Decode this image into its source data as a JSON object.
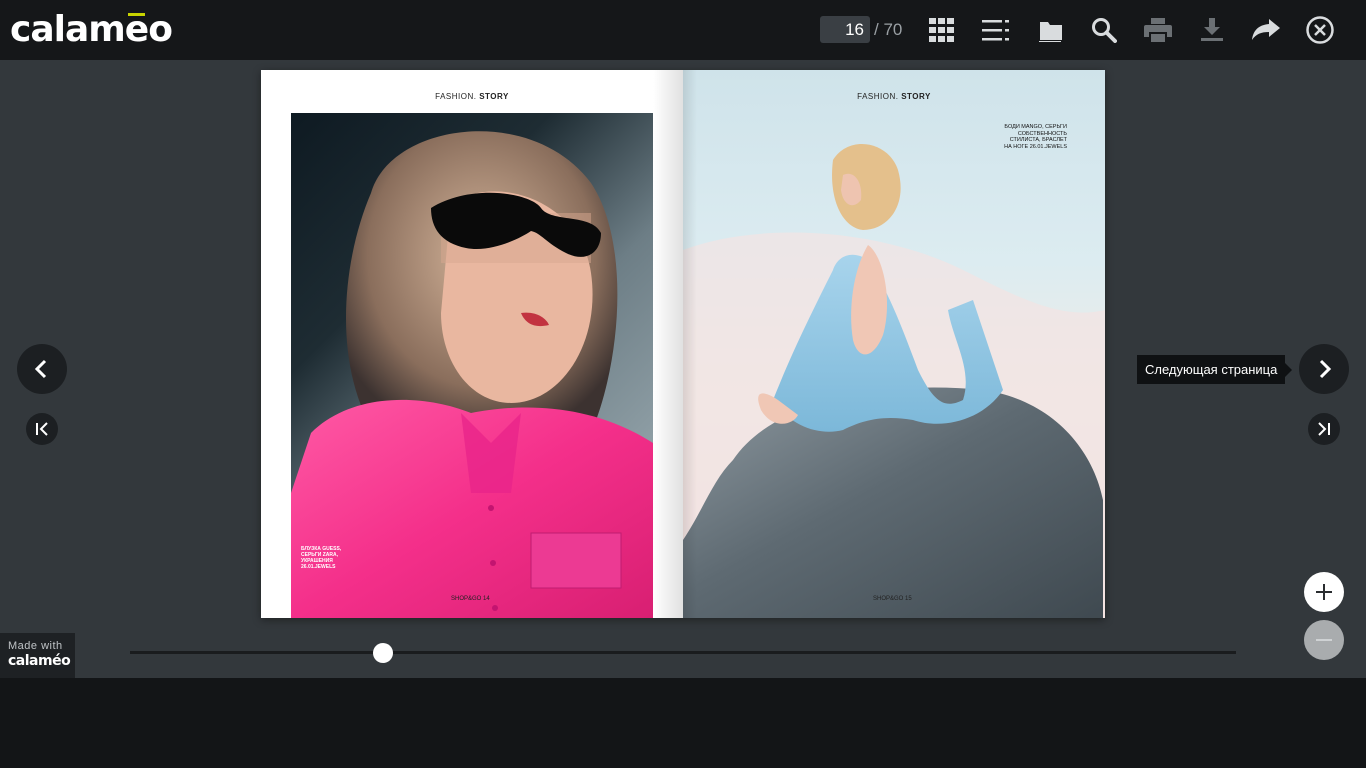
{
  "app": {
    "logo": "calaméo",
    "logo_left": "calam",
    "logo_e": "e",
    "logo_right": "o"
  },
  "toolbar": {
    "current_page": "16",
    "total_pages": "/ 70",
    "icons": [
      "grid-icon",
      "list-icon",
      "folder-icon",
      "search-icon",
      "print-icon",
      "download-icon",
      "share-icon",
      "close-icon"
    ]
  },
  "spread": {
    "left": {
      "running_head": "FASHION.",
      "running_head_bold": "STORY",
      "caption_lines": [
        "БЛУЗКА GUESS,",
        "СЕРЬГИ ZARA,",
        "УКРАШЕНИЯ",
        "26.01.JEWELS"
      ],
      "folio": "SHOP&GO 14"
    },
    "right": {
      "running_head": "FASHION.",
      "running_head_bold": "STORY",
      "caption_lines": [
        "БОДИ MANGO, СЕРЬГИ",
        "СОБСТВЕННОСТЬ",
        "СТИЛИСТА, БРАСЛЕТ",
        "НА НОГЕ 26.01.JEWELS"
      ],
      "folio": "SHOP&GO 15"
    }
  },
  "tooltip": {
    "next_page": "Следующая страница"
  },
  "slider": {
    "position_fraction": 0.229
  },
  "madewith": {
    "label": "Made with",
    "brand": "calaméo"
  },
  "colors": {
    "accent": "#c8d400",
    "stage": "#33383c",
    "topbar": "#151719"
  }
}
